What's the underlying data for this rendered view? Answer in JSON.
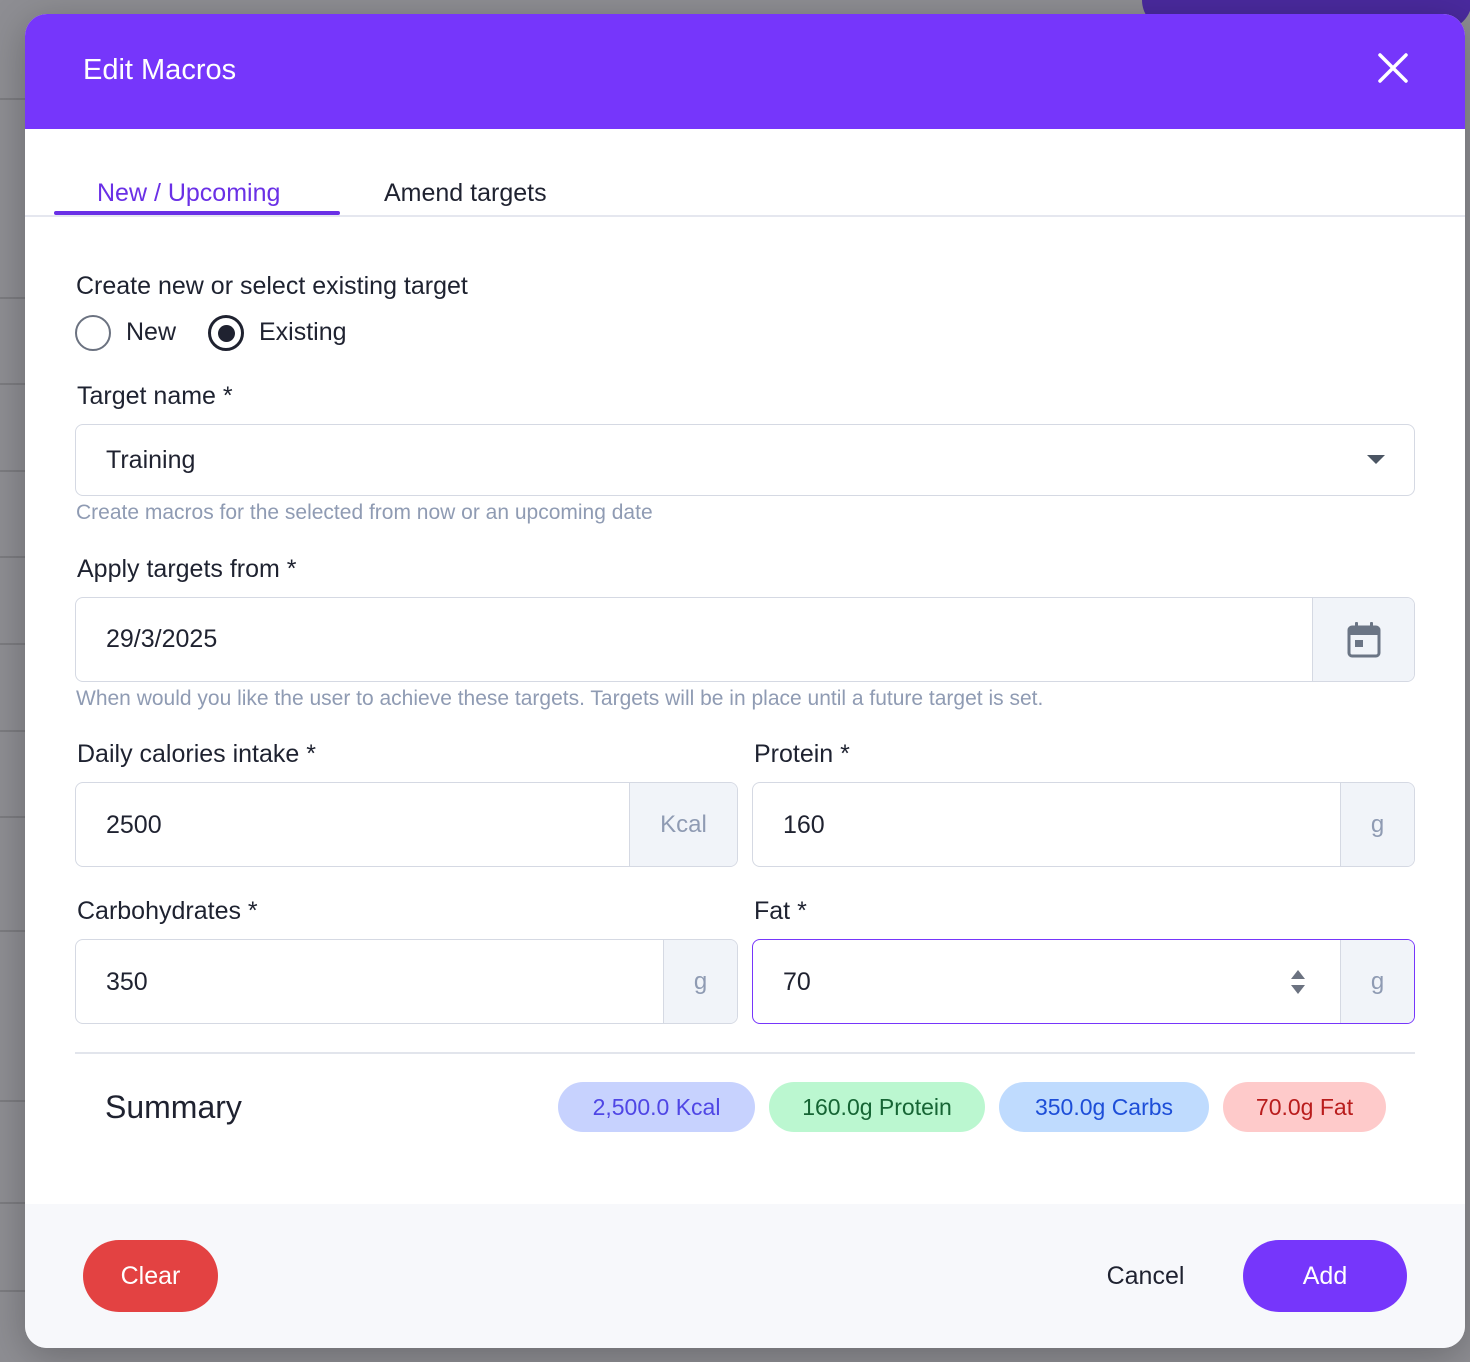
{
  "modal": {
    "title": "Edit Macros"
  },
  "tabs": [
    {
      "label": "New / Upcoming",
      "active": true
    },
    {
      "label": "Amend targets",
      "active": false
    }
  ],
  "target_mode": {
    "label": "Create new or select existing target",
    "options": [
      "New",
      "Existing"
    ],
    "selected": "Existing"
  },
  "target_name": {
    "label": "Target name *",
    "value": "Training",
    "helper": "Create macros for the selected from now or an upcoming date"
  },
  "apply_from": {
    "label": "Apply targets from *",
    "value": "29/3/2025",
    "helper": "When would you like the user to achieve these targets. Targets will be in place until a future target is set."
  },
  "calories": {
    "label": "Daily calories intake *",
    "value": "2500",
    "unit": "Kcal"
  },
  "protein": {
    "label": "Protein *",
    "value": "160",
    "unit": "g"
  },
  "carbs": {
    "label": "Carbohydrates *",
    "value": "350",
    "unit": "g"
  },
  "fat": {
    "label": "Fat *",
    "value": "70",
    "unit": "g"
  },
  "summary": {
    "title": "Summary",
    "chips": [
      {
        "text": "2,500.0 Kcal",
        "bg": "#c7d2fe",
        "fg": "#4f46e5"
      },
      {
        "text": "160.0g Protein",
        "bg": "#bbf7d0",
        "fg": "#166534"
      },
      {
        "text": "350.0g Carbs",
        "bg": "#bfdbfe",
        "fg": "#1d4ed8"
      },
      {
        "text": "70.0g Fat",
        "bg": "#fecaca",
        "fg": "#b91c1c"
      }
    ]
  },
  "footer": {
    "clear_label": "Clear",
    "cancel_label": "Cancel",
    "add_label": "Add"
  },
  "colors": {
    "primary": "#7636fb",
    "danger": "#e34242"
  }
}
